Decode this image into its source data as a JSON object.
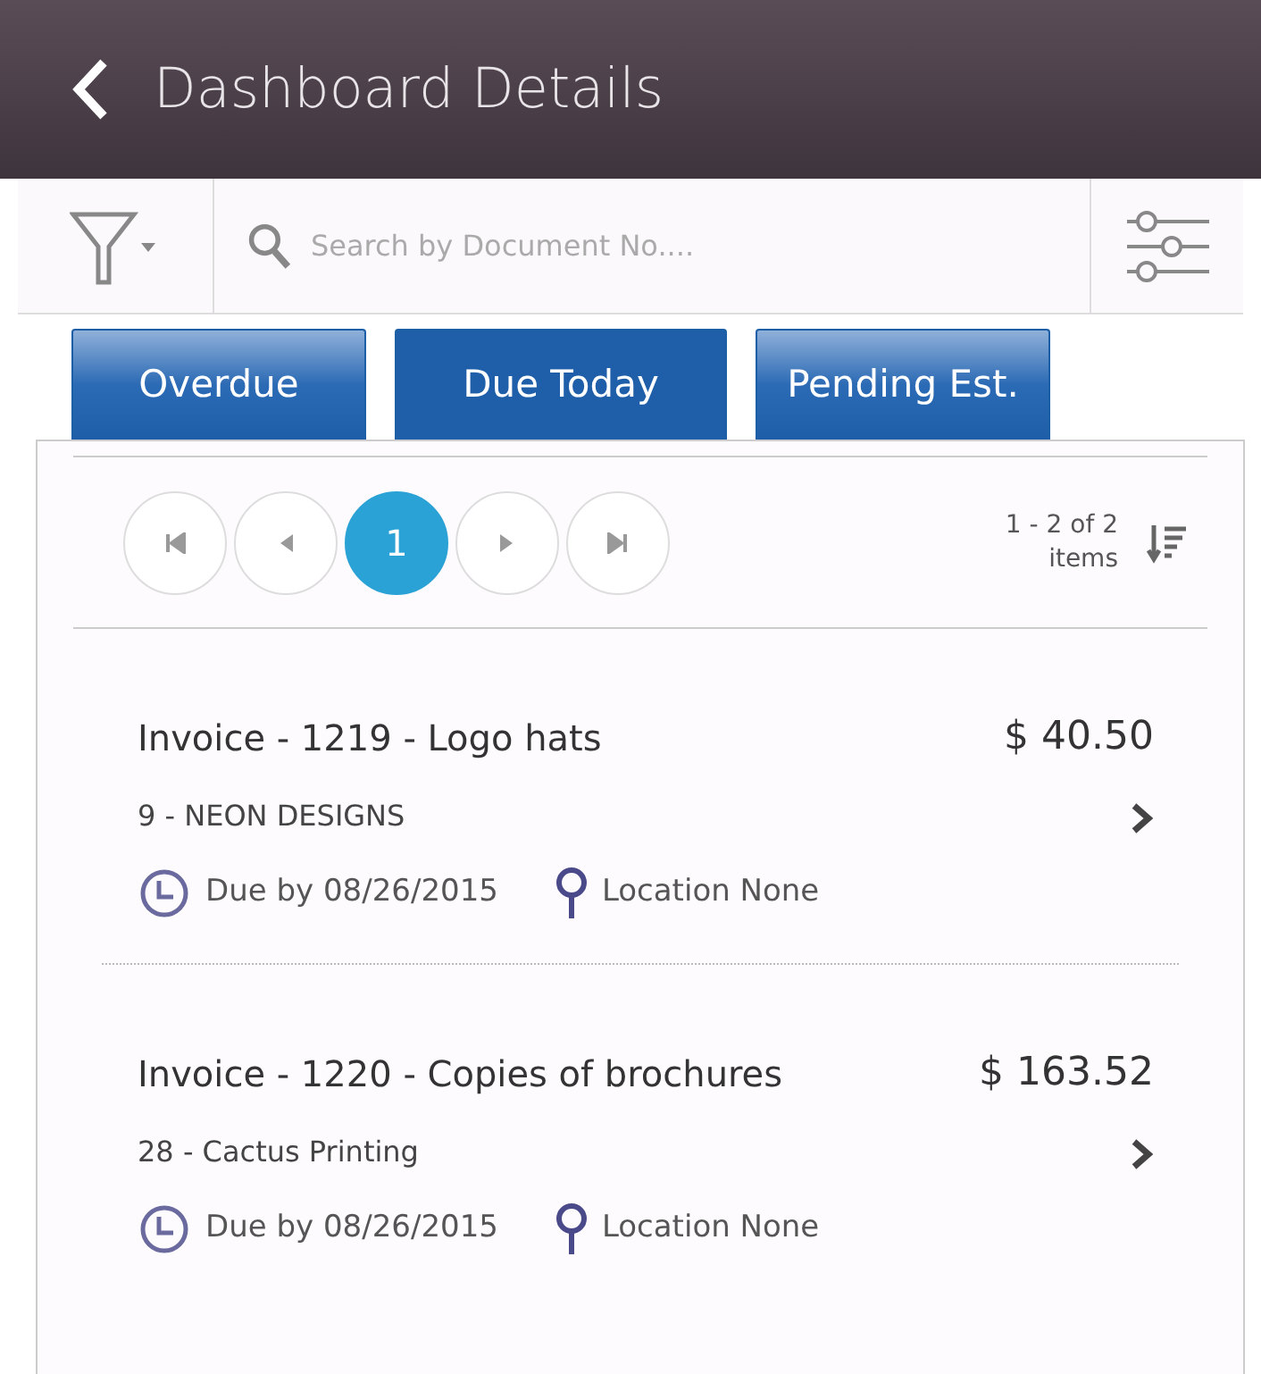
{
  "header": {
    "title": "Dashboard Details"
  },
  "search": {
    "placeholder": "Search by Document No...."
  },
  "tabs": [
    {
      "label": "Overdue",
      "selected": false
    },
    {
      "label": "Due Today",
      "selected": true
    },
    {
      "label": "Pending Est.",
      "selected": false
    }
  ],
  "pager": {
    "pages": [
      {
        "label": "1",
        "selected": true
      }
    ],
    "range": "1 - 2 of 2",
    "unit": "items"
  },
  "items": [
    {
      "title": "Invoice - 1219 - Logo hats",
      "amount": "$ 40.50",
      "customer": "9 - NEON DESIGNS",
      "due": "Due by 08/26/2015",
      "location": "Location None"
    },
    {
      "title": "Invoice - 1220 - Copies of brochures",
      "amount": "$ 163.52",
      "customer": "28 - Cactus Printing",
      "due": "Due by 08/26/2015",
      "location": "Location None"
    }
  ]
}
